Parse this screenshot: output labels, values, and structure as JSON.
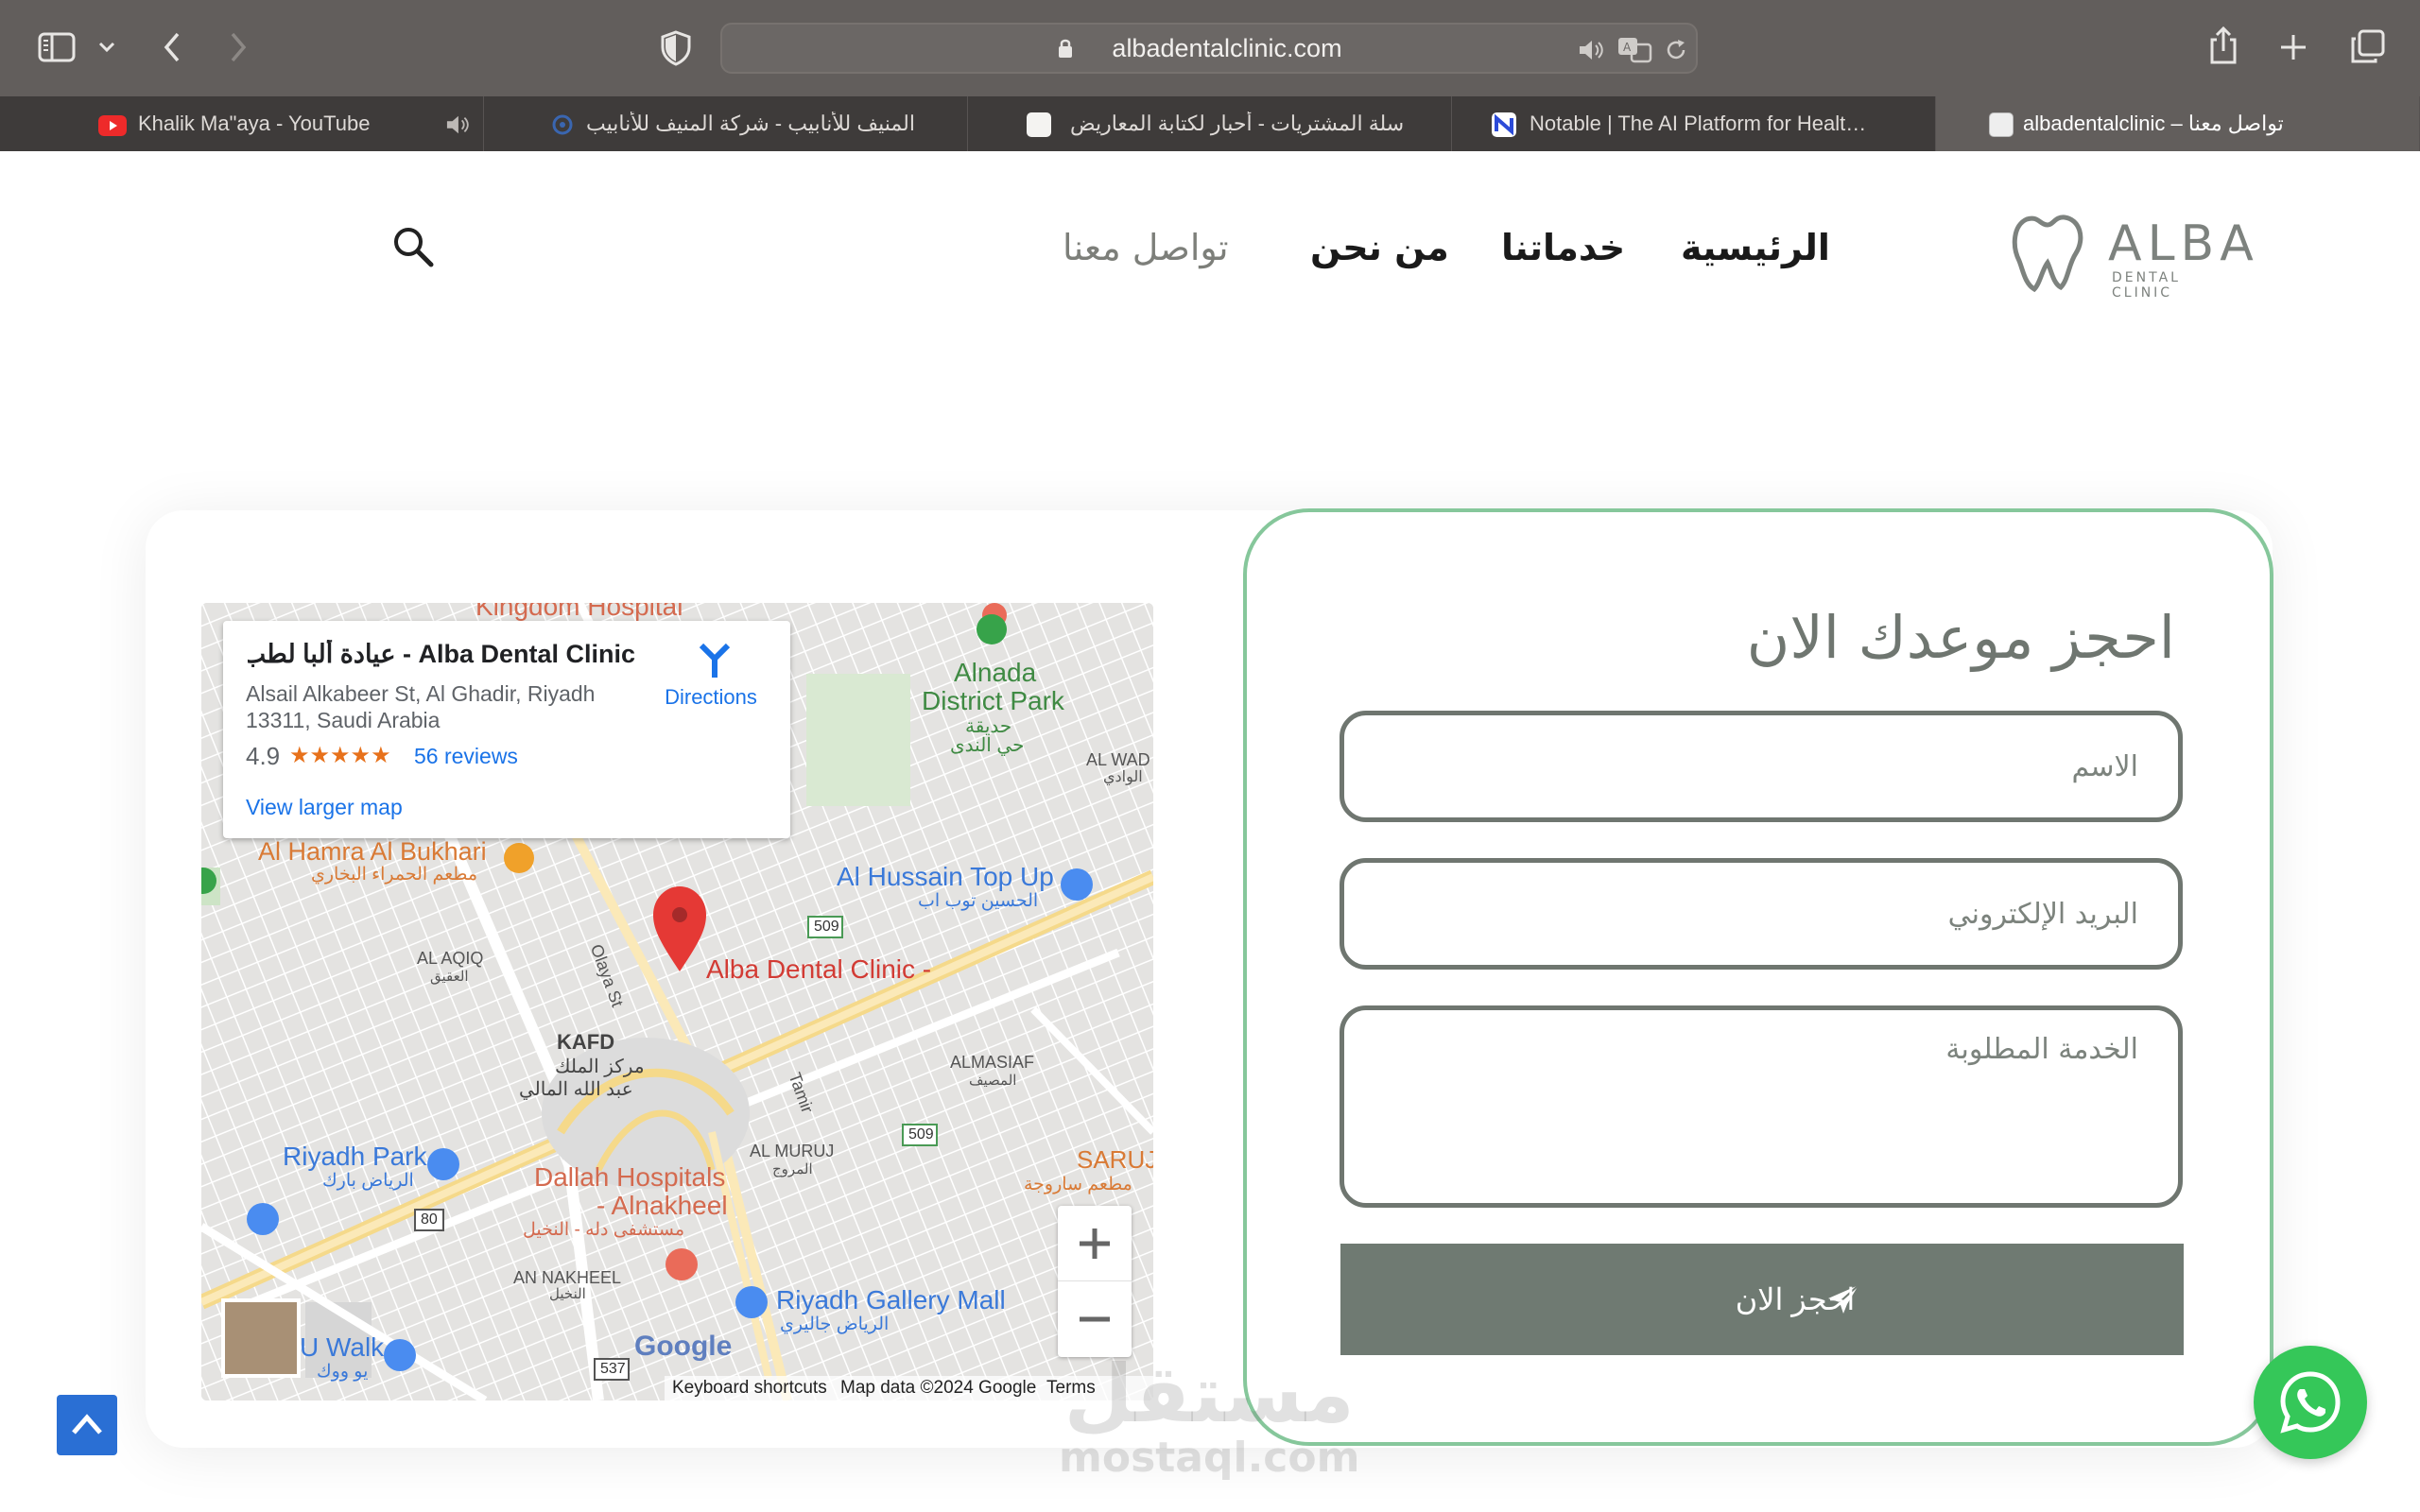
{
  "browser": {
    "url": "albadentalclinic.com",
    "tabs": [
      {
        "title": "Khalik Ma\"aya - YouTube",
        "favicon": "youtube-icon",
        "muted_audio": true
      },
      {
        "title": "المنيف للأنابيب - شركة المنيف للأنابيب",
        "favicon": "almunif-icon"
      },
      {
        "title": "سلة المشتريات - أحبار لكتابة المعاريض",
        "favicon": "ahbar-icon"
      },
      {
        "title": "Notable | The AI Platform for Healt…",
        "favicon": "notable-icon"
      },
      {
        "title": "albadentalclinic – تواصل معنا",
        "favicon": "alba-icon",
        "active": true
      }
    ]
  },
  "header": {
    "logo_text": "ALBA",
    "logo_subtext": "DENTAL CLINIC",
    "nav": {
      "home": "الرئيسية",
      "services": "خدماتنا",
      "about": "من نحن",
      "contact": "تواصل معنا"
    }
  },
  "map": {
    "place_name": "Alba Dental Clinic - عيادة ألبا لطب …",
    "address_line1": "Alsail Alkabeer St, Al Ghadir, Riyadh",
    "address_line2": "13311, Saudi Arabia",
    "rating": "4.9",
    "stars": "★★★★★",
    "reviews": "56 reviews",
    "directions": "Directions",
    "view_larger": "View larger map",
    "marker_label": "Alba Dental Clinic -",
    "labels": {
      "kingdom_hospital": "Kingdom Hospital",
      "alnada_park": "Alnada",
      "alnada_park2": "District Park",
      "alnada_ar1": "حديقة",
      "alnada_ar2": "حي الندى",
      "al_wadi": "AL WAD",
      "al_wadi_ar": "الوادي",
      "al_hamra": "Al Hamra Al Bukhari",
      "al_hamra_ar": "مطعم الحمراء البخاري",
      "al_hussain": "Al Hussain Top Up",
      "al_hussain_ar": "الحسين توب اب",
      "al_aqiq": "AL AQIQ",
      "al_aqiq_ar": "العقيق",
      "olaya": "Olaya St",
      "kafd": "KAFD",
      "kafd_ar1": "مركز الملك",
      "kafd_ar2": "عبد الله المالي",
      "almasiaf": "ALMASIAF",
      "almasiaf_ar": "المصيف",
      "tamir": "Tamir",
      "al_muruj": "AL MURUJ",
      "al_muruj_ar": "المروج",
      "saruj": "SARUJ",
      "saruj_ar": "مطعم ساروجة",
      "riyadh_park": "Riyadh Park",
      "riyadh_park_ar": "الرياض بارك",
      "dallah1": "Dallah Hospitals",
      "dallah2": "- Alnakheel",
      "dallah_ar": "مستشفى دله - النخيل",
      "an_nakheel": "AN NAKHEEL",
      "an_nakheel_ar": "النخيل",
      "gallery_mall": "Riyadh Gallery Mall",
      "gallery_mall_ar": "الرياض جاليري",
      "u_walk": "U Walk",
      "u_walk_ar": "يو ووك",
      "route_509a": "509",
      "route_509b": "509",
      "route_80": "80",
      "route_537": "537"
    },
    "footer": {
      "shortcuts": "Keyboard shortcuts",
      "map_data": "Map data ©2024 Google",
      "terms": "Terms"
    },
    "google": "Google"
  },
  "form": {
    "title": "احجز موعدك الان",
    "name_placeholder": "الاسم",
    "email_placeholder": "البريد الإلكتروني",
    "service_placeholder": "الخدمة المطلوبة",
    "submit_label": "احجز الان"
  },
  "watermark": {
    "line1": "مستقل",
    "line2": "mostaql.com"
  },
  "colors": {
    "accent_green": "#86c79b",
    "button_gray": "#6f7a72",
    "whatsapp_green": "#35c759",
    "scroll_blue": "#2a6fd4"
  }
}
